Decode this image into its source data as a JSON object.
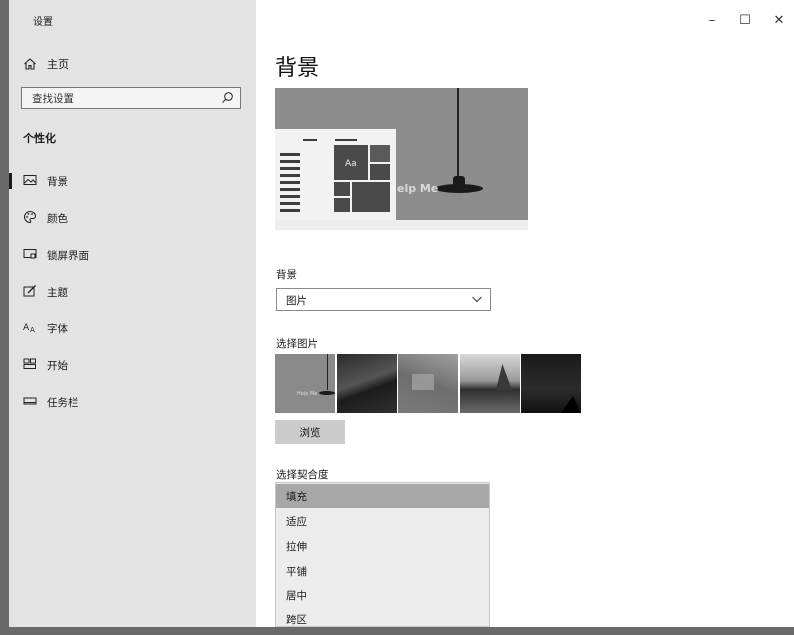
{
  "window": {
    "title": "设置",
    "controls": {
      "minimize": "–",
      "maximize": "☐",
      "close": "✕"
    }
  },
  "sidebar": {
    "home_label": "主页",
    "search_placeholder": "查找设置",
    "section_title": "个性化",
    "items": [
      {
        "label": "背景",
        "icon": "picture-icon",
        "active": true
      },
      {
        "label": "颜色",
        "icon": "palette-icon",
        "active": false
      },
      {
        "label": "锁屏界面",
        "icon": "lock-screen-icon",
        "active": false
      },
      {
        "label": "主题",
        "icon": "theme-brush-icon",
        "active": false
      },
      {
        "label": "字体",
        "icon": "font-icon",
        "active": false
      },
      {
        "label": "开始",
        "icon": "start-icon",
        "active": false
      },
      {
        "label": "任务栏",
        "icon": "taskbar-icon",
        "active": false
      }
    ]
  },
  "main": {
    "title": "背景",
    "preview": {
      "sample_text": "Aa",
      "wallpaper_text": "elp Me"
    },
    "background": {
      "label": "背景",
      "value": "图片"
    },
    "choose_picture": {
      "label": "选择图片",
      "thumb1_text": "Help Me"
    },
    "browse_label": "浏览",
    "fit": {
      "label": "选择契合度",
      "options": [
        "填充",
        "适应",
        "拉伸",
        "平铺",
        "居中",
        "跨区"
      ],
      "selected_index": 0
    }
  }
}
